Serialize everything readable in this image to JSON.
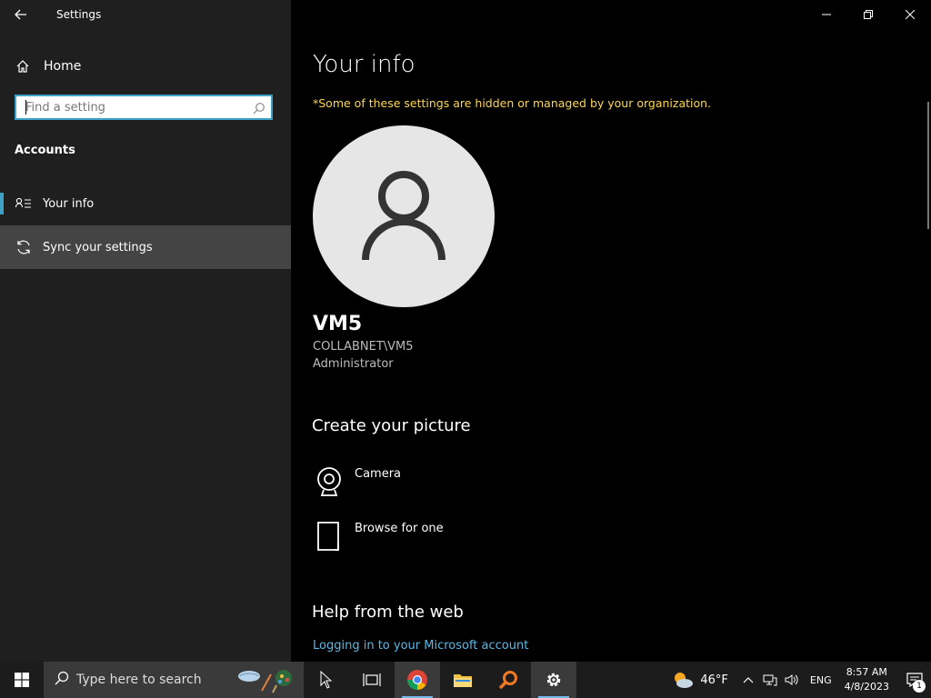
{
  "window": {
    "title": "Settings",
    "controls": {
      "minimize": "—",
      "maximize": "❐",
      "close": "✕"
    }
  },
  "sidebar": {
    "home_label": "Home",
    "search": {
      "placeholder": "Find a setting"
    },
    "section_label": "Accounts",
    "items": [
      {
        "label": "Your info",
        "icon": "contact-info-icon",
        "active": true
      },
      {
        "label": "Sync your settings",
        "icon": "sync-icon",
        "hover": true
      }
    ]
  },
  "main": {
    "title": "Your info",
    "notice": "*Some of these settings are hidden or managed by your organization.",
    "user": {
      "name": "VM5",
      "account": "COLLABNET\\VM5",
      "role": "Administrator"
    },
    "create_picture": {
      "heading": "Create your picture",
      "options": [
        {
          "label": "Camera",
          "icon": "camera-icon"
        },
        {
          "label": "Browse for one",
          "icon": "browse-file-icon"
        }
      ]
    },
    "help": {
      "heading": "Help from the web",
      "link": "Logging in to your Microsoft account"
    }
  },
  "taskbar": {
    "search_placeholder": "Type here to search",
    "apps": [
      {
        "name": "task-view",
        "running": false
      },
      {
        "name": "chrome",
        "running": true
      },
      {
        "name": "file-explorer",
        "running": false
      },
      {
        "name": "search-app",
        "running": false
      },
      {
        "name": "settings",
        "running": true,
        "active": true
      }
    ],
    "weather": {
      "temp": "46°F"
    },
    "language": "ENG",
    "clock": {
      "time": "8:57 AM",
      "date": "4/8/2023"
    },
    "notification_count": "1"
  },
  "colors": {
    "accent": "#3ea2c8",
    "notice": "#fdd64d",
    "link": "#5cb8e6",
    "sidebar_bg": "#1f1f1f",
    "main_bg": "#000000"
  }
}
